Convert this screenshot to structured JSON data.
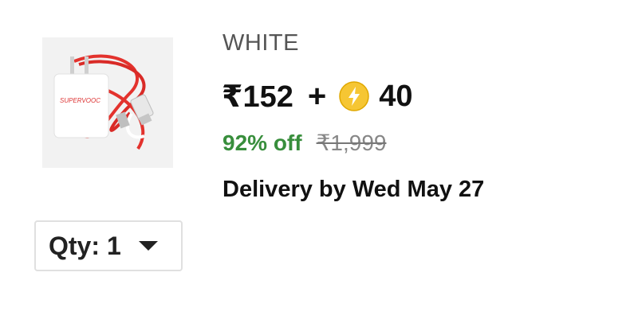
{
  "product": {
    "image_alt": "Charger product image",
    "variant": "WHITE",
    "logo_text": "SUPERVOOC"
  },
  "pricing": {
    "price": "₹152",
    "plus": "+",
    "coins_icon": "lightning-coin-icon",
    "coins": "40",
    "discount": "92% off",
    "mrp": "₹1,999"
  },
  "delivery": {
    "text": "Delivery by Wed May 27"
  },
  "quantity": {
    "label": "Qty:",
    "value": "1",
    "icon": "dropdown-caret-icon"
  },
  "colors": {
    "discount_green": "#388e3c",
    "coin_yellow": "#f6c633",
    "cable_red": "#e3322d"
  }
}
